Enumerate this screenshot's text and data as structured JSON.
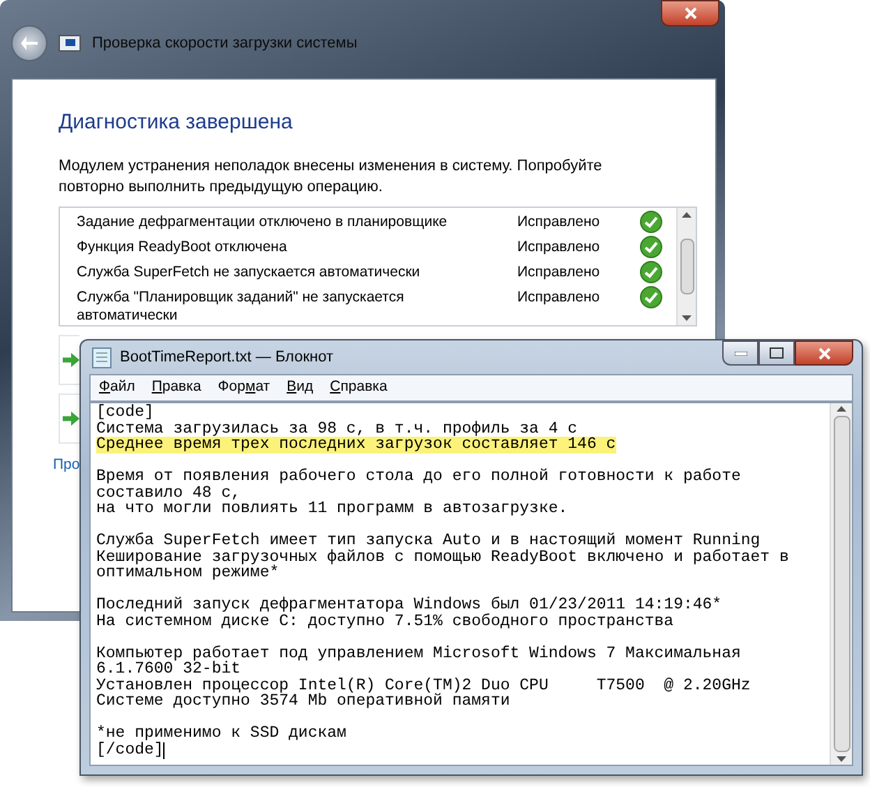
{
  "back_window": {
    "title": "Проверка скорости загрузки системы",
    "heading": "Диагностика завершена",
    "description": "Модулем устранения неполадок внесены изменения в систему. Попробуйте повторно выполнить предыдущую операцию.",
    "issues": [
      {
        "name": "Задание дефрагментации отключено в планировщике",
        "status": "Исправлено"
      },
      {
        "name": "Функция ReadyBoot отключена",
        "status": "Исправлено"
      },
      {
        "name": "Служба SuperFetch не запускается автоматически",
        "status": "Исправлено"
      },
      {
        "name": "Служба \"Планировщик заданий\" не запускается автоматически",
        "status": "Исправлено"
      }
    ],
    "link": "Про"
  },
  "notepad": {
    "title": "BootTimeReport.txt — Блокнот",
    "menu": [
      {
        "key": "Ф",
        "after": "айл"
      },
      {
        "key": "П",
        "after": "равка"
      },
      {
        "before": "Фор",
        "key": "м",
        "after": "ат"
      },
      {
        "key": "В",
        "after": "ид"
      },
      {
        "key": "С",
        "after": "правка"
      }
    ],
    "paragraphs": [
      [
        {
          "text": "[code]",
          "highlighted": false
        },
        {
          "text": "Система загрузилась за 98 с, в т.ч. профиль за 4 с",
          "highlighted": false
        },
        {
          "text": "Среднее время трех последних загрузок составляет 146 с",
          "highlighted": true
        }
      ],
      [
        {
          "text": "Время от появления рабочего стола до его полной готовности к работе",
          "highlighted": false
        },
        {
          "text": "составило 48 с,",
          "highlighted": false
        },
        {
          "text": "на что могли повлиять 11 программ в автозагрузке.",
          "highlighted": false
        }
      ],
      [
        {
          "text": "Служба SuperFetch имеет тип запуска Auto и в настоящий момент Running",
          "highlighted": false
        },
        {
          "text": "Кеширование загрузочных файлов с помощью ReadyBoot включено и работает в",
          "highlighted": false
        },
        {
          "text": "оптимальном режиме*",
          "highlighted": false
        }
      ],
      [
        {
          "text": "Последний запуск дефрагментатора Windows был 01/23/2011 14:19:46*",
          "highlighted": false
        },
        {
          "text": "На системном диске C: доступно 7.51% свободного пространства",
          "highlighted": false
        }
      ],
      [
        {
          "text": "Компьютер работает под управлением Microsoft Windows 7 Максимальная",
          "highlighted": false
        },
        {
          "text": "6.1.7600 32-bit",
          "highlighted": false
        },
        {
          "text": "Установлен процессор Intel(R) Core(TM)2 Duo CPU     T7500  @ 2.20GHz",
          "highlighted": false
        },
        {
          "text": "Системе доступно 3574 Mb оперативной памяти",
          "highlighted": false
        }
      ],
      [
        {
          "text": "*не применимо к SSD дискам",
          "highlighted": false
        },
        {
          "text": "[/code]",
          "highlighted": false
        }
      ]
    ]
  }
}
